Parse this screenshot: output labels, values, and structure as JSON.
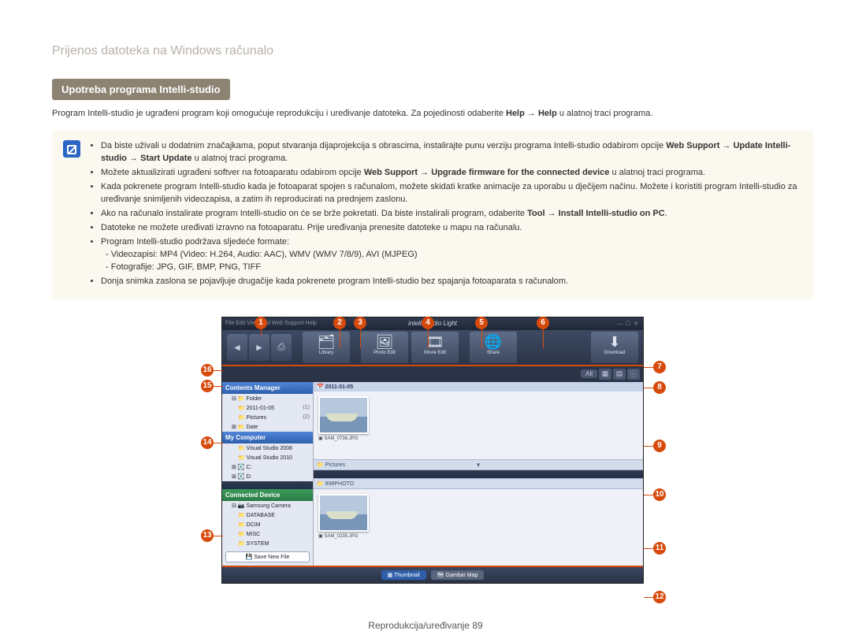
{
  "page_title": "Prijenos datoteka na Windows računalo",
  "section_badge": "Upotreba programa Intelli-studio",
  "intro_pre": "Program Intelli-studio je ugrađeni program koji omogućuje reprodukciju i uređivanje datoteka. Za pojedinosti odaberite ",
  "intro_b1": "Help",
  "intro_arrow": " → ",
  "intro_b2": "Help",
  "intro_post": " u alatnoj traci programa.",
  "info": {
    "li1_a": "Da biste uživali u dodatnim značajkama, poput stvaranja dijaprojekcija s obrascima, instalirajte punu verziju programa Intelli-studio odabirom opcije ",
    "li1_b": "Web Support",
    "li1_c": " → ",
    "li1_d": "Update Intelli-studio",
    "li1_e": " → ",
    "li1_f": "Start Update",
    "li1_g": " u alatnoj traci programa.",
    "li2_a": "Možete aktualizirati ugrađeni softver na fotoaparatu odabirom opcije ",
    "li2_b": "Web Support",
    "li2_c": " → ",
    "li2_d": "Upgrade firmware for the connected device",
    "li2_e": " u alatnoj traci programa.",
    "li3": "Kada pokrenete program Intelli-studio kada je fotoaparat spojen s računalom, možete skidati kratke animacije za uporabu u dječijem načinu. Možete i koristiti program Intelli-studio za uređivanje snimljenih videozapisa, a zatim ih reproducirati na prednjem zaslonu.",
    "li4_a": "Ako na računalo instalirate program Intelli-studio on će se brže pokretati. Da biste instalirali program, odaberite ",
    "li4_b": "Tool",
    "li4_c": " → ",
    "li4_d": "Install Intelli-studio on PC",
    "li4_e": ".",
    "li5": "Datoteke ne možete uređivati izravno na fotoaparatu. Prije uređivanja prenesite datoteke u mapu na računalu.",
    "li6": "Program Intelli-studio podržava sljedeće formate:",
    "li6a": "Videozapisi: MP4 (Video: H.264, Audio: AAC), WMV (WMV 7/8/9), AVI (MJPEG)",
    "li6b": "Fotografije: JPG, GIF, BMP, PNG, TIFF",
    "li7": "Donja snimka zaslona se pojavljuje drugačije kada pokrenete program Intelli-studio bez spajanja fotoaparata s računalom."
  },
  "callouts": {
    "n1": "1",
    "n2": "2",
    "n3": "3",
    "n4": "4",
    "n5": "5",
    "n6": "6",
    "n7": "7",
    "n8": "8",
    "n9": "9",
    "n10": "10",
    "n11": "11",
    "n12": "12",
    "n13": "13",
    "n14": "14",
    "n15": "15",
    "n16": "16"
  },
  "app": {
    "menu": "File  Edit  View  Tool  Web Support  Help",
    "logo": "intelli-studio Light",
    "tiles": {
      "library": "Library",
      "photo": "Photo Edit",
      "movie": "Movie Edit",
      "share": "Share",
      "download": "Download"
    },
    "view_all": "All",
    "sidebar": {
      "contents": "Contents Manager",
      "folder": "Folder",
      "date_folder": "2011-01-05",
      "date_folder_cnt": "(1)",
      "pictures": "Pictures",
      "pictures_cnt": "(2)",
      "date": "Date",
      "mycomputer": "My Computer",
      "vs2008": "Visual Studio 2008",
      "vs2010": "Visual Studio 2010",
      "c": "C:",
      "d": "D:",
      "connected": "Connected Device",
      "camera": "Samsung Camera",
      "database": "DATABASE",
      "dcim": "DCIM",
      "misc": "MISC",
      "system": "SYSTEM",
      "save": "Save New File"
    },
    "content": {
      "date": "2011-01-05",
      "thumb1": "SAM_0736.JPG",
      "cat1": "Pictures",
      "folder2": "998PHOTO",
      "thumb2": "SAM_0235.JPG"
    },
    "status": {
      "thumb": "Thumbnail",
      "map": "Gambar Map"
    }
  },
  "footer_label": "Reprodukcija/uređivanje  ",
  "footer_page": "89"
}
